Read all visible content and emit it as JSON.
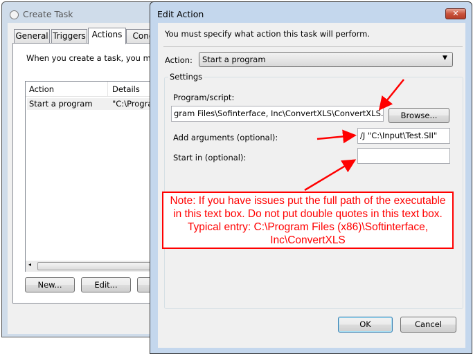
{
  "create_task": {
    "title": "Create Task",
    "tabs": [
      {
        "label": "General"
      },
      {
        "label": "Triggers"
      },
      {
        "label": "Actions",
        "selected": true
      },
      {
        "label": "Cond"
      }
    ],
    "description": "When you create a task, you must",
    "columns": [
      "Action",
      "Details"
    ],
    "rows": [
      {
        "action": "Start a program",
        "details": "\"C:\\Progra"
      }
    ],
    "buttons": {
      "new": "New...",
      "edit": "Edit..."
    }
  },
  "edit_action": {
    "title": "Edit Action",
    "instruction": "You must specify what action this task will perform.",
    "action_label": "Action:",
    "action_value": "Start a program",
    "settings_label": "Settings",
    "program_label": "Program/script:",
    "program_value": "gram Files\\Sofinterface, Inc\\ConvertXLS\\ConvertXLS.EXE\"",
    "browse": "Browse...",
    "arguments_label": "Add arguments (optional):",
    "arguments_value": "/J \"C:\\Input\\Test.SII\"",
    "start_in_label": "Start in (optional):",
    "start_in_value": "",
    "ok": "OK",
    "cancel": "Cancel"
  },
  "annotation": {
    "note": "Note: If you have issues put the full path of the executable in this text box. Do not put double quotes in this text box. Typical entry: C:\\Program Files (x86)\\Softinterface, Inc\\ConvertXLS",
    "color": "#ff0000"
  }
}
